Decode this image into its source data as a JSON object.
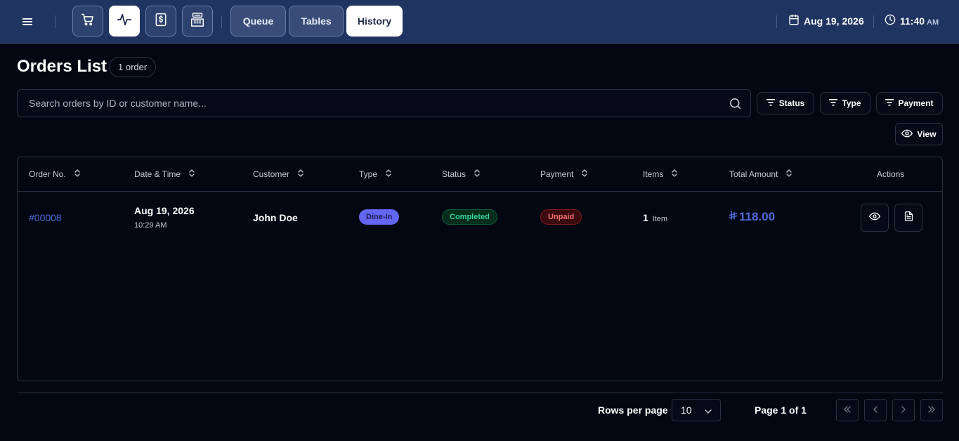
{
  "topbar": {
    "nav_icons": [
      "cart-icon",
      "activity-icon",
      "dollar-receipt-icon",
      "cash-register-icon"
    ],
    "active_nav_icon": "activity-icon",
    "tabs": [
      {
        "label": "Queue",
        "active": false
      },
      {
        "label": "Tables",
        "active": false
      },
      {
        "label": "History",
        "active": true
      }
    ],
    "date": "Aug 19, 2026",
    "time": "11:40",
    "ampm": "AM"
  },
  "page": {
    "title": "Orders List",
    "count_label": "1 order"
  },
  "search": {
    "placeholder": "Search orders by ID or customer name...",
    "value": ""
  },
  "filters": {
    "status": "Status",
    "type": "Type",
    "payment": "Payment",
    "view": "View"
  },
  "table": {
    "headers": {
      "order_no": "Order No.",
      "date_time": "Date & Time",
      "customer": "Customer",
      "type": "Type",
      "status": "Status",
      "payment": "Payment",
      "items": "Items",
      "total": "Total Amount",
      "actions": "Actions"
    },
    "rows": [
      {
        "order_no": "#00008",
        "date": "Aug 19, 2026",
        "time": "10:29 AM",
        "customer": "John Doe",
        "type": "Dine-In",
        "status": "Completed",
        "payment": "Unpaid",
        "items_count": "1",
        "items_label": "Item",
        "total": "118.00",
        "currency_icon": "riyal-icon"
      }
    ]
  },
  "colors": {
    "topbar_bg": "#1f3461",
    "page_bg": "#030712",
    "accent_blue": "#4f6bd8",
    "type_badge": "#6366f1",
    "status_green": "#34d399",
    "payment_red": "#f87171"
  },
  "pagination": {
    "rows_per_page_label": "Rows per page",
    "rows_per_page_value": "10",
    "page_info": "Page 1 of 1"
  }
}
